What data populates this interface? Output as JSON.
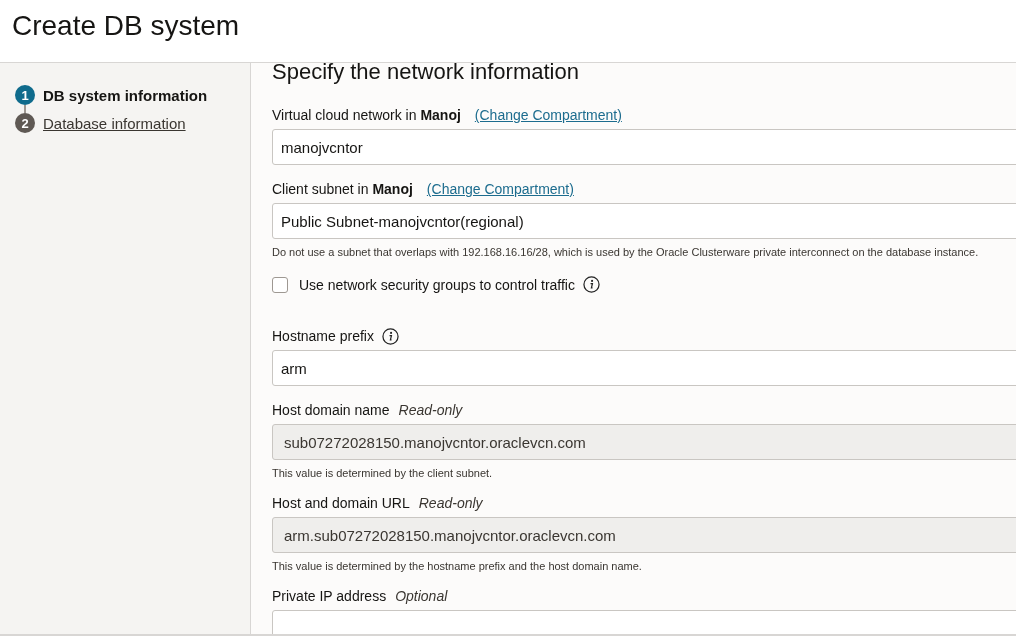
{
  "page": {
    "title": "Create DB system"
  },
  "steps": [
    {
      "number": "1",
      "label": "DB system information",
      "selected": true
    },
    {
      "number": "2",
      "label": "Database information",
      "selected": false
    }
  ],
  "section": {
    "title": "Specify the network information"
  },
  "fields": [
    {
      "kind": "input",
      "label": "Virtual cloud network in **Manoj**",
      "link": "(Change Compartment)",
      "value": "manojvcntor",
      "readonly": false
    },
    {
      "kind": "input",
      "label": "Client subnet in **Manoj**",
      "link": "(Change Compartment)",
      "value": "Public Subnet-manojvcntor(regional)",
      "readonly": false,
      "help": "Do not use a subnet that overlaps with 192.168.16.16/28, which is used by the Oracle Clusterware private interconnect on the database instance."
    },
    {
      "kind": "checkbox",
      "label": "Use network security groups to control traffic",
      "checked": false,
      "info": true
    },
    {
      "kind": "input",
      "label": "Hostname prefix",
      "info": true,
      "value": "arm",
      "readonly": false
    },
    {
      "kind": "input",
      "label": "Host domain name",
      "tag": "Read-only",
      "value": "sub07272028150.manojvcntor.oraclevcn.com",
      "readonly": true,
      "help": "This value is determined by the client subnet."
    },
    {
      "kind": "input",
      "label": "Host and domain URL",
      "tag": "Read-only",
      "value": "arm.sub07272028150.manojvcntor.oraclevcn.com",
      "readonly": true,
      "help": "This value is determined by the hostname prefix and the host domain name."
    },
    {
      "kind": "input",
      "label": "Private IP address",
      "tag": "Optional",
      "readonly": false
    }
  ]
}
